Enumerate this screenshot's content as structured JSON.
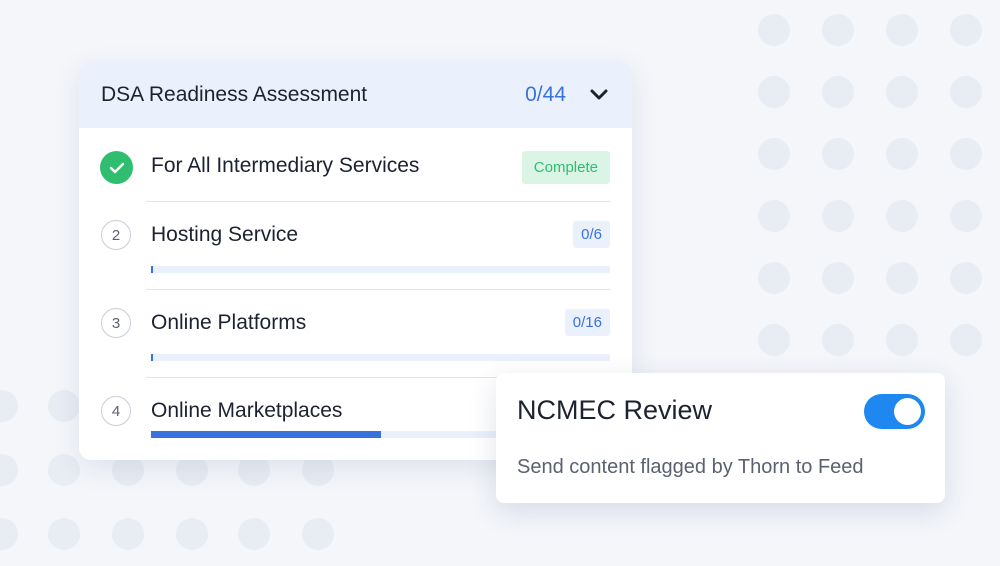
{
  "colors": {
    "accent": "#3a72dd",
    "success": "#2fbe6f",
    "toggle_on": "#1e87f0",
    "header_bg": "#eaf0fc"
  },
  "assessment": {
    "title": "DSA Readiness Assessment",
    "count": "0/44",
    "expand_icon": "chevron-down-icon",
    "sections": [
      {
        "number": "",
        "status_icon": "check-icon",
        "label": "For All Intermediary Services",
        "badge": "Complete",
        "progress": null
      },
      {
        "number": "2",
        "label": "Hosting Service",
        "badge": "0/6",
        "progress": 0.005
      },
      {
        "number": "3",
        "label": "Online Platforms",
        "badge": "0/16",
        "progress": 0.005
      },
      {
        "number": "4",
        "label": "Online Marketplaces",
        "badge": "",
        "progress": 0.5
      }
    ]
  },
  "ncmec": {
    "title": "NCMEC Review",
    "description": "Send content flagged by Thorn to Feed",
    "toggle_on": true
  }
}
